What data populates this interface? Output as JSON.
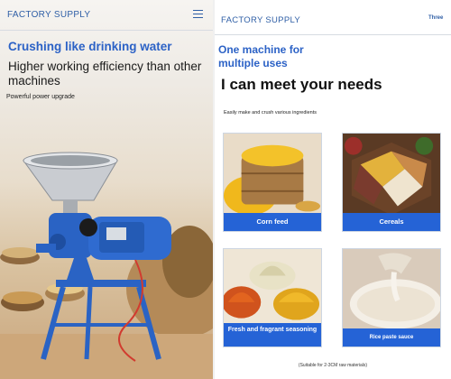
{
  "left": {
    "header_title": "FACTORY SUPPLY",
    "headline": "Crushing like drinking water",
    "subheadline": "Higher working efficiency than other machines",
    "caption": "Powerful power upgrade"
  },
  "right": {
    "header_title": "FACTORY SUPPLY",
    "page_index": "Three",
    "headline": "One machine for multiple uses",
    "subheadline": "I can meet your needs",
    "intro": "Easily make and crush various ingredients",
    "cards": [
      {
        "label": "Corn feed"
      },
      {
        "label": "Cereals"
      },
      {
        "label": "Fresh and fragrant seasoning"
      },
      {
        "label": "Rice paste sauce"
      }
    ],
    "footnote": "(Suitable for 2-3CM raw materials)"
  },
  "colors": {
    "accent": "#2c62c6",
    "label_bar": "#2563d6",
    "machine_body": "#2a63c4"
  }
}
